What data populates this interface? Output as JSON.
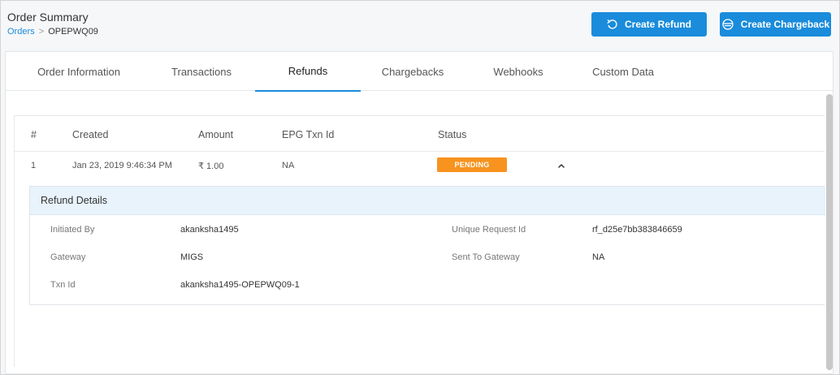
{
  "header": {
    "title": "Order Summary",
    "breadcrumb": {
      "parent": "Orders",
      "separator": ">",
      "current": "OPEPWQ09"
    },
    "buttons": {
      "create_refund": "Create Refund",
      "create_chargeback": "Create Chargeback"
    }
  },
  "tabs": [
    {
      "label": "Order Information",
      "active": false
    },
    {
      "label": "Transactions",
      "active": false
    },
    {
      "label": "Refunds",
      "active": true
    },
    {
      "label": "Chargebacks",
      "active": false
    },
    {
      "label": "Webhooks",
      "active": false
    },
    {
      "label": "Custom Data",
      "active": false
    }
  ],
  "refunds_table": {
    "headers": [
      "#",
      "Created",
      "Amount",
      "EPG Txn Id",
      "Status"
    ],
    "rows": [
      {
        "index": "1",
        "created": "Jan 23, 2019 9:46:34 PM",
        "amount": "₹ 1.00",
        "epg_txn_id": "NA",
        "status": "PENDING",
        "expanded": true
      }
    ]
  },
  "refund_details": {
    "title": "Refund Details",
    "fields": {
      "initiated_by": {
        "label": "Initiated By",
        "value": "akanksha1495"
      },
      "gateway": {
        "label": "Gateway",
        "value": "MIGS"
      },
      "txn_id": {
        "label": "Txn Id",
        "value": "akanksha1495-OPEPWQ09-1"
      },
      "unique_request_id": {
        "label": "Unique Request Id",
        "value": "rf_d25e7bb383846659"
      },
      "sent_to_gateway": {
        "label": "Sent To Gateway",
        "value": "NA"
      }
    }
  },
  "colors": {
    "accent": "#1a8cdb",
    "pending": "#f7931e",
    "details_header_bg": "#e8f3fb"
  },
  "icons": {
    "refund": "rotate-ccw-icon",
    "chargeback": "card-icon",
    "collapse": "chevron-up-icon"
  }
}
